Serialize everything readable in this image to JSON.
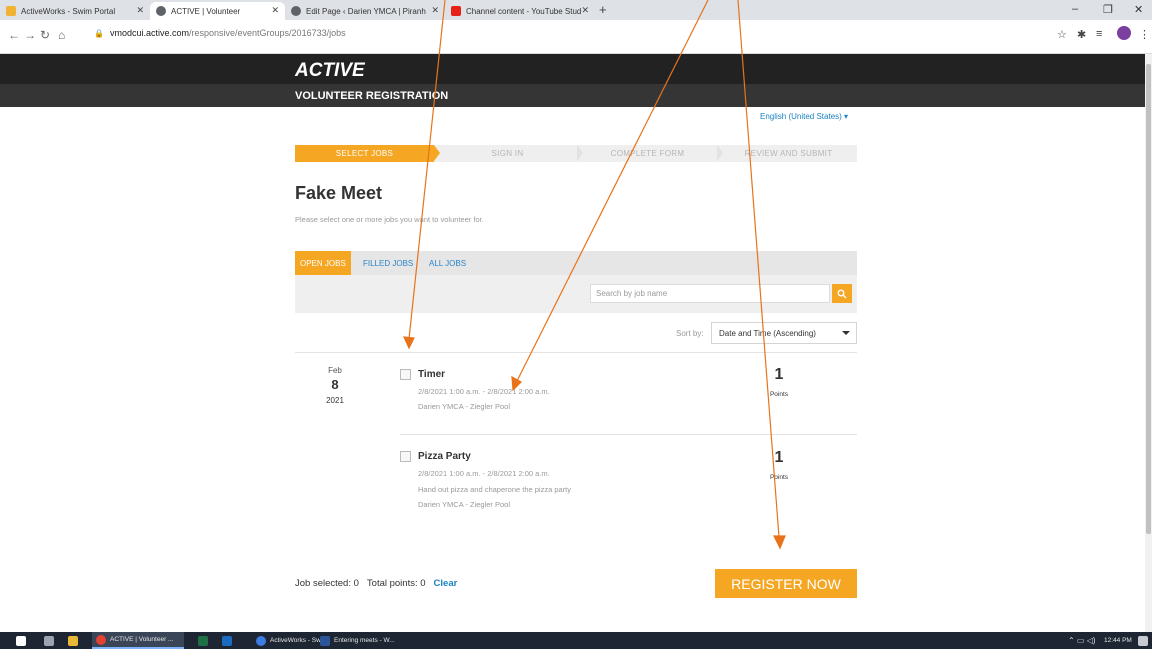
{
  "browser": {
    "tabs": [
      {
        "label": "ActiveWorks - Swim Portal",
        "icon": "activeworks-icon",
        "color": "#f2b233"
      },
      {
        "label": "ACTIVE | Volunteer",
        "icon": "globe-icon",
        "color": "#5f6368"
      },
      {
        "label": "Edit Page ‹ Darien YMCA | Piranh",
        "icon": "globe-icon",
        "color": "#5f6368"
      },
      {
        "label": "Channel content - YouTube Stud",
        "icon": "youtube-icon",
        "color": "#e62117"
      }
    ],
    "url_domain": "vmodcui.active.com",
    "url_path": "/responsive/eventGroups/2016733/jobs"
  },
  "header": {
    "brand": "ACTIVE",
    "section": "VOLUNTEER REGISTRATION"
  },
  "language": "English (United States) ▾",
  "steps": [
    "SELECT JOBS",
    "SIGN IN",
    "COMPLETE FORM",
    "REVIEW AND SUBMIT"
  ],
  "event": {
    "title": "Fake Meet",
    "instructions": "Please select one or more jobs you want to volunteer for."
  },
  "filters": {
    "tabs": [
      "OPEN JOBS",
      "FILLED JOBS",
      "ALL JOBS"
    ],
    "active": "OPEN JOBS",
    "search_placeholder": "Search by job name"
  },
  "sort": {
    "label": "Sort by:",
    "selected": "Date and Time (Ascending)"
  },
  "date_group": {
    "month": "Feb",
    "day": "8",
    "year": "2021"
  },
  "jobs": [
    {
      "name": "Timer",
      "time": "2/8/2021 1:00 a.m.  -  2/8/2021 2:00 a.m.",
      "description": "",
      "location": "Darien YMCA - Ziegler Pool",
      "points": "1",
      "points_label": "Points"
    },
    {
      "name": "Pizza Party",
      "time": "2/8/2021 1:00 a.m.  -  2/8/2021 2:00 a.m.",
      "description": "Hand out pizza and chaperone the pizza party",
      "location": "Darien YMCA - Ziegler Pool",
      "points": "1",
      "points_label": "Points"
    }
  ],
  "summary": {
    "job_selected": "Job selected: 0",
    "total_points": "Total points: 0",
    "clear": "Clear"
  },
  "register_button": "REGISTER NOW",
  "taskbar": {
    "items": [
      "ACTIVE | Volunteer ...",
      "ActiveWorks - Swi...",
      "Entering meets - W..."
    ],
    "time": "12:44 PM"
  },
  "colors": {
    "accent": "#f5a623",
    "link": "#1a82c4",
    "annotation_arrow": "#e8731a"
  }
}
